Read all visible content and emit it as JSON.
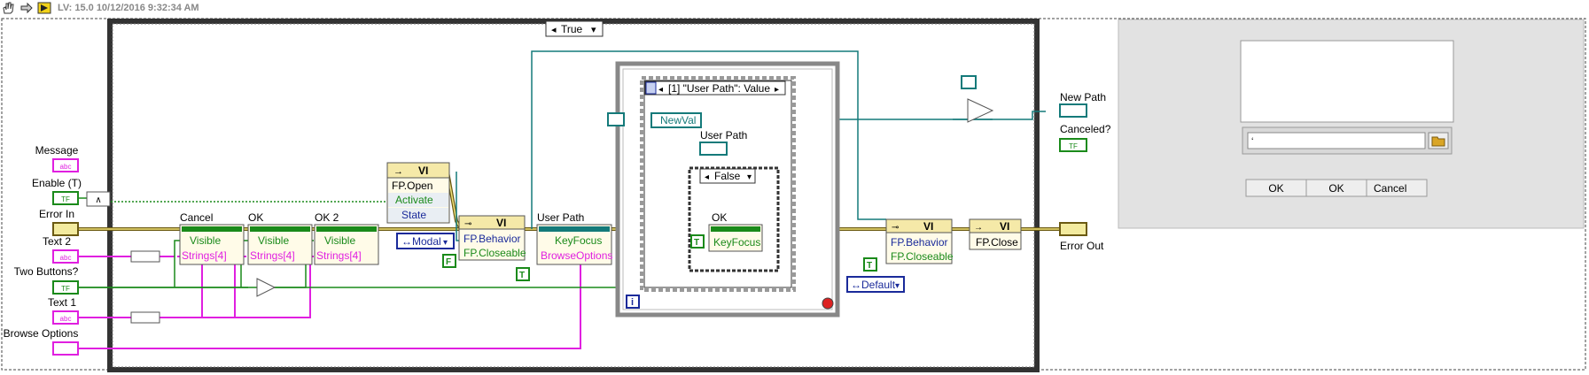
{
  "toolbar": {
    "title": "LV: 15.0 10/12/2016 9:32:34 AM",
    "icons": [
      "hand-icon",
      "arrow-icon",
      "run-arrow-icon"
    ]
  },
  "diagram": {
    "case_selector": "True",
    "inputs": {
      "message": "Message",
      "enable": "Enable (T)",
      "error_in": "Error In",
      "text2": "Text 2",
      "two_buttons": "Two Buttons?",
      "text1": "Text 1",
      "browse_options": "Browse Options"
    },
    "nodes": {
      "cancel": {
        "title": "Cancel",
        "props": [
          "Visible",
          "Strings[4]"
        ]
      },
      "ok": {
        "title": "OK",
        "props": [
          "Visible",
          "Strings[4]"
        ]
      },
      "ok2": {
        "title": "OK 2",
        "props": [
          "Visible",
          "Strings[4]"
        ]
      },
      "vi_open": {
        "header": "VI",
        "props": [
          "FP.Open",
          "Activate",
          "State"
        ]
      },
      "vi_behavior": {
        "header": "VI",
        "props": [
          "FP.Behavior",
          "FP.Closeable"
        ]
      },
      "user_path": {
        "title": "User Path",
        "props": [
          "KeyFocus",
          "BrowseOptions"
        ]
      },
      "vi_behavior2": {
        "header": "VI",
        "props": [
          "FP.Behavior",
          "FP.Closeable"
        ]
      },
      "vi_close": {
        "header": "VI",
        "props": [
          "FP.Close"
        ]
      }
    },
    "constants": {
      "modal": "Modal",
      "default": "Default",
      "false1": "F",
      "true1": "T",
      "true2": "T",
      "true3": "T",
      "tf": "TF"
    },
    "event_structure": {
      "selector": "[1] \"User Path\": Value",
      "newval": "NewVal",
      "user_path_label": "User Path",
      "inner_case": "False",
      "ok_label": "OK",
      "keyfocus": "KeyFocus",
      "loop_index": "i"
    },
    "outputs": {
      "new_path": "New Path",
      "canceled": "Canceled?",
      "error_out": "Error Out"
    }
  },
  "front_panel": {
    "buttons": [
      "OK",
      "OK",
      "Cancel"
    ],
    "path_prefix": "‘"
  }
}
